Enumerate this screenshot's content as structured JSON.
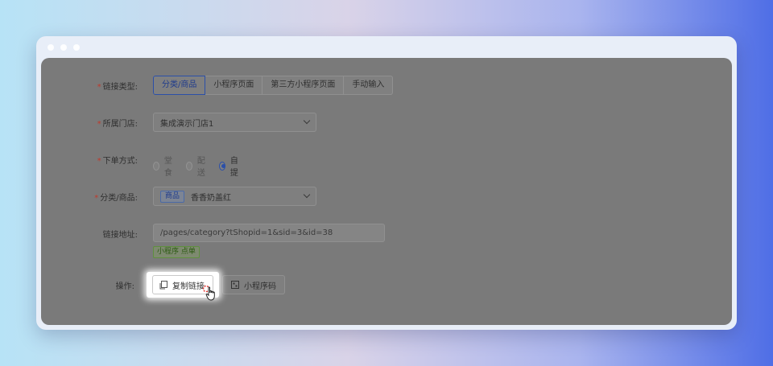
{
  "form": {
    "link_type": {
      "label": "链接类型:",
      "options": [
        "分类/商品",
        "小程序页面",
        "第三方小程序页面",
        "手动输入"
      ],
      "selected": "分类/商品"
    },
    "store": {
      "label": "所属门店:",
      "value": "集成演示门店1"
    },
    "order_mode": {
      "label": "下单方式:",
      "options": [
        "堂食",
        "配送",
        "自提"
      ],
      "selected": "自提"
    },
    "category": {
      "label": "分类/商品:",
      "tag": "商品",
      "value": "香香奶盖红"
    },
    "link_address": {
      "label": "链接地址:",
      "value": "/pages/category?tShopid=1&sid=3&id=38",
      "badge": "小程序 点单"
    },
    "actions": {
      "label": "操作:",
      "copy_label": "复制链接",
      "qrcode_label": "小程序码"
    }
  },
  "colors": {
    "accent": "#2b4fa8",
    "required": "#c0392b",
    "overlay": "#7a7a7a"
  }
}
